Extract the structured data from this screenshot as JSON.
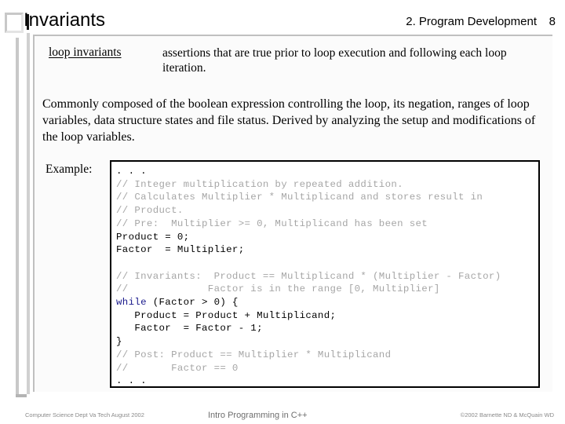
{
  "header": {
    "title": "Invariants",
    "section": "2. Program Development",
    "page_number": "8"
  },
  "definition": {
    "term": "loop invariants",
    "text": "assertions that are true prior to loop execution and following each loop iteration."
  },
  "paragraph": "Commonly composed of the boolean expression controlling the loop, its negation, ranges of loop variables, data structure states and file status.  Derived by analyzing the setup and modifications of the loop variables.",
  "example": {
    "label": "Example:",
    "code_lines": [
      {
        "text": ". . .",
        "style": "code"
      },
      {
        "text": "// Integer multiplication by repeated addition.",
        "style": "comment"
      },
      {
        "text": "// Calculates Multiplier * Multiplicand and stores result in",
        "style": "comment"
      },
      {
        "text": "// Product.",
        "style": "comment"
      },
      {
        "text": "// Pre:  Multiplier >= 0, Multiplicand has been set",
        "style": "comment"
      },
      {
        "text": "Product = 0;",
        "style": "code"
      },
      {
        "text": "Factor  = Multiplier;",
        "style": "code"
      },
      {
        "text": "",
        "style": "blank"
      },
      {
        "text": "// Invariants:  Product == Multiplicand * (Multiplier - Factor)",
        "style": "comment"
      },
      {
        "text": "//             Factor is in the range [0, Multiplier]",
        "style": "comment"
      },
      {
        "text": "while (Factor > 0) {",
        "style": "code",
        "keyword": "while"
      },
      {
        "text": "   Product = Product + Multiplicand;",
        "style": "code"
      },
      {
        "text": "   Factor  = Factor - 1;",
        "style": "code"
      },
      {
        "text": "}",
        "style": "code"
      },
      {
        "text": "// Post: Product == Multiplier * Multiplicand",
        "style": "comment"
      },
      {
        "text": "//       Factor == 0",
        "style": "comment"
      },
      {
        "text": ". . .",
        "style": "code"
      }
    ]
  },
  "footer": {
    "left": "Computer Science Dept Va Tech August 2002",
    "center": "Intro Programming in C++",
    "right": "©2002  Barnette ND & McQuain WD"
  },
  "colors": {
    "comment": "#a6a6a6",
    "keyword": "#1a1a8c",
    "code": "#000000",
    "panel_border": "#c0c0c0",
    "rail": "#c8c8c8"
  }
}
